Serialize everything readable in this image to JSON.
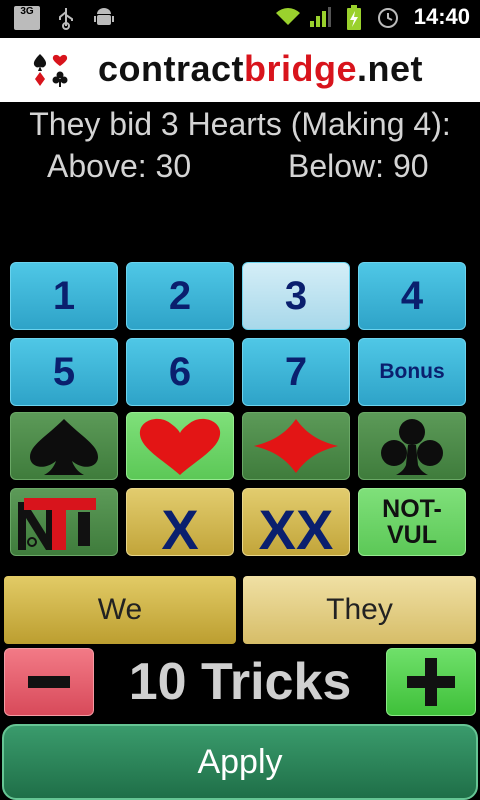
{
  "status_bar": {
    "network": "3G",
    "time": "14:40",
    "icons": [
      "usb-icon",
      "android-debug-icon",
      "wifi-icon",
      "signal-icon",
      "battery-charging-icon",
      "alarm-icon"
    ]
  },
  "header": {
    "logo_text_a": "contract",
    "logo_text_b": "bridge",
    "logo_text_c": ".net",
    "brand_red": "#d8141c"
  },
  "summary": {
    "line": "They bid 3 Hearts (Making 4):",
    "above": "Above: 30",
    "below": "Below: 90"
  },
  "levels": [
    "1",
    "2",
    "3",
    "4",
    "5",
    "6",
    "7"
  ],
  "selected_level": "3",
  "bonus_label": "Bonus",
  "suits": [
    "spade-icon",
    "heart-icon",
    "diamond-icon",
    "club-icon"
  ],
  "selected_suit": "heart-icon",
  "doubles": {
    "double_label": "X",
    "redouble_label": "XX",
    "vul_line1": "NOT-",
    "vul_line2": "VUL"
  },
  "sides": {
    "we_label": "We",
    "they_label": "They"
  },
  "tricks_label": "10 Tricks",
  "apply_label": "Apply"
}
